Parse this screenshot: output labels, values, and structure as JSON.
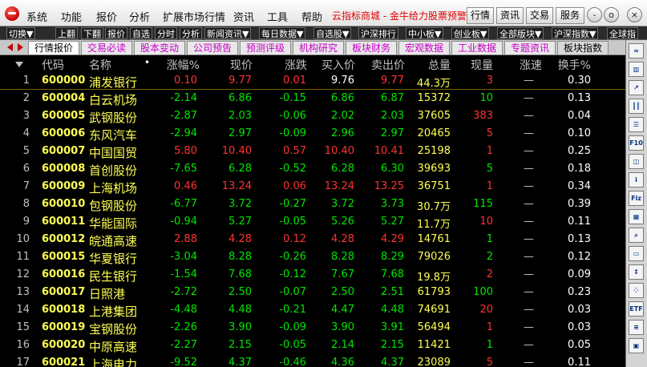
{
  "menu": {
    "items": [
      "系统",
      "功能",
      "报价",
      "分析",
      "扩展市场行情",
      "资讯",
      "工具",
      "帮助"
    ],
    "title": "云指标商城 - 金牛给力股票预警",
    "modes": [
      "行情",
      "资讯",
      "交易",
      "服务"
    ]
  },
  "window_controls": [
    "-",
    "o",
    "□",
    "×"
  ],
  "toolbar": [
    "切换▼",
    "上翻",
    "下翻",
    "报价",
    "自选",
    "分时",
    "分析",
    "新闻资讯▼",
    "每日数据▼",
    "自选股▼",
    "沪深排行",
    "中小板▼",
    "创业板▼",
    "全部版块▼",
    "沪深指数▼",
    "全球指"
  ],
  "tabs": [
    "行情报价",
    "交易必读",
    "股本变动",
    "公司预告",
    "预测评级",
    "机构研究",
    "板块财务",
    "宏观数据",
    "工业数据",
    "专题资讯",
    "板块指数"
  ],
  "table": {
    "sort_marker": "•",
    "columns": [
      "代码",
      "名称",
      "涨幅%",
      "现价",
      "涨跌",
      "买入价",
      "卖出价",
      "总量",
      "现量",
      "涨速",
      "换手%"
    ],
    "rows": [
      {
        "n": "1",
        "code": "600000",
        "name": "浦发银行",
        "pct": "0.10",
        "price": "9.77",
        "chg": "0.01",
        "bid": "9.76",
        "ask": "9.77",
        "vol": "44.3万",
        "cur": "3",
        "speed": "—",
        "turn": "0.30",
        "dir": "up",
        "bid_dir": "flat",
        "ask_dir": "up",
        "cur_dir": "up"
      },
      {
        "n": "2",
        "code": "600004",
        "name": "白云机场",
        "pct": "-2.14",
        "price": "6.86",
        "chg": "-0.15",
        "bid": "6.86",
        "ask": "6.87",
        "vol": "15372",
        "cur": "10",
        "speed": "—",
        "turn": "0.13",
        "dir": "dn",
        "bid_dir": "dn",
        "ask_dir": "dn",
        "cur_dir": "dn"
      },
      {
        "n": "3",
        "code": "600005",
        "name": "武钢股份",
        "pct": "-2.87",
        "price": "2.03",
        "chg": "-0.06",
        "bid": "2.02",
        "ask": "2.03",
        "vol": "37605",
        "cur": "383",
        "speed": "—",
        "turn": "0.04",
        "dir": "dn",
        "bid_dir": "dn",
        "ask_dir": "dn",
        "cur_dir": "up"
      },
      {
        "n": "4",
        "code": "600006",
        "name": "东风汽车",
        "pct": "-2.94",
        "price": "2.97",
        "chg": "-0.09",
        "bid": "2.96",
        "ask": "2.97",
        "vol": "20465",
        "cur": "5",
        "speed": "—",
        "turn": "0.10",
        "dir": "dn",
        "bid_dir": "dn",
        "ask_dir": "dn",
        "cur_dir": "up"
      },
      {
        "n": "5",
        "code": "600007",
        "name": "中国国贸",
        "pct": "5.80",
        "price": "10.40",
        "chg": "0.57",
        "bid": "10.40",
        "ask": "10.41",
        "vol": "25198",
        "cur": "1",
        "speed": "—",
        "turn": "0.25",
        "dir": "up",
        "bid_dir": "up",
        "ask_dir": "up",
        "cur_dir": "up"
      },
      {
        "n": "6",
        "code": "600008",
        "name": "首创股份",
        "pct": "-7.65",
        "price": "6.28",
        "chg": "-0.52",
        "bid": "6.28",
        "ask": "6.30",
        "vol": "39693",
        "cur": "5",
        "speed": "—",
        "turn": "0.18",
        "dir": "dn",
        "bid_dir": "dn",
        "ask_dir": "dn",
        "cur_dir": "dn"
      },
      {
        "n": "7",
        "code": "600009",
        "name": "上海机场",
        "pct": "0.46",
        "price": "13.24",
        "chg": "0.06",
        "bid": "13.24",
        "ask": "13.25",
        "vol": "36751",
        "cur": "1",
        "speed": "—",
        "turn": "0.34",
        "dir": "up",
        "bid_dir": "up",
        "ask_dir": "up",
        "cur_dir": "up"
      },
      {
        "n": "8",
        "code": "600010",
        "name": "包钢股份",
        "pct": "-6.77",
        "price": "3.72",
        "chg": "-0.27",
        "bid": "3.72",
        "ask": "3.73",
        "vol": "30.7万",
        "cur": "115",
        "speed": "—",
        "turn": "0.39",
        "dir": "dn",
        "bid_dir": "dn",
        "ask_dir": "dn",
        "cur_dir": "dn"
      },
      {
        "n": "9",
        "code": "600011",
        "name": "华能国际",
        "pct": "-0.94",
        "price": "5.27",
        "chg": "-0.05",
        "bid": "5.26",
        "ask": "5.27",
        "vol": "11.7万",
        "cur": "10",
        "speed": "—",
        "turn": "0.11",
        "dir": "dn",
        "bid_dir": "dn",
        "ask_dir": "dn",
        "cur_dir": "up"
      },
      {
        "n": "10",
        "code": "600012",
        "name": "皖通高速",
        "pct": "2.88",
        "price": "4.28",
        "chg": "0.12",
        "bid": "4.28",
        "ask": "4.29",
        "vol": "14761",
        "cur": "1",
        "speed": "—",
        "turn": "0.13",
        "dir": "up",
        "bid_dir": "up",
        "ask_dir": "up",
        "cur_dir": "dn"
      },
      {
        "n": "11",
        "code": "600015",
        "name": "华夏银行",
        "pct": "-3.04",
        "price": "8.28",
        "chg": "-0.26",
        "bid": "8.28",
        "ask": "8.29",
        "vol": "79026",
        "cur": "2",
        "speed": "—",
        "turn": "0.12",
        "dir": "dn",
        "bid_dir": "dn",
        "ask_dir": "dn",
        "cur_dir": "dn"
      },
      {
        "n": "12",
        "code": "600016",
        "name": "民生银行",
        "pct": "-1.54",
        "price": "7.68",
        "chg": "-0.12",
        "bid": "7.67",
        "ask": "7.68",
        "vol": "19.8万",
        "cur": "2",
        "speed": "—",
        "turn": "0.09",
        "dir": "dn",
        "bid_dir": "dn",
        "ask_dir": "dn",
        "cur_dir": "up"
      },
      {
        "n": "13",
        "code": "600017",
        "name": "日照港",
        "pct": "-2.72",
        "price": "2.50",
        "chg": "-0.07",
        "bid": "2.50",
        "ask": "2.51",
        "vol": "61793",
        "cur": "100",
        "speed": "—",
        "turn": "0.23",
        "dir": "dn",
        "bid_dir": "dn",
        "ask_dir": "dn",
        "cur_dir": "dn"
      },
      {
        "n": "14",
        "code": "600018",
        "name": "上港集团",
        "pct": "-4.48",
        "price": "4.48",
        "chg": "-0.21",
        "bid": "4.47",
        "ask": "4.48",
        "vol": "74691",
        "cur": "20",
        "speed": "—",
        "turn": "0.03",
        "dir": "dn",
        "bid_dir": "dn",
        "ask_dir": "dn",
        "cur_dir": "up"
      },
      {
        "n": "15",
        "code": "600019",
        "name": "宝钢股份",
        "pct": "-2.26",
        "price": "3.90",
        "chg": "-0.09",
        "bid": "3.90",
        "ask": "3.91",
        "vol": "56494",
        "cur": "1",
        "speed": "—",
        "turn": "0.03",
        "dir": "dn",
        "bid_dir": "dn",
        "ask_dir": "dn",
        "cur_dir": "up"
      },
      {
        "n": "16",
        "code": "600020",
        "name": "中原高速",
        "pct": "-2.27",
        "price": "2.15",
        "chg": "-0.05",
        "bid": "2.14",
        "ask": "2.15",
        "vol": "11421",
        "cur": "1",
        "speed": "—",
        "turn": "0.05",
        "dir": "dn",
        "bid_dir": "dn",
        "ask_dir": "dn",
        "cur_dir": "dn"
      },
      {
        "n": "17",
        "code": "600021",
        "name": "上海电力",
        "pct": "-9.52",
        "price": "4.37",
        "chg": "-0.46",
        "bid": "4.36",
        "ask": "4.37",
        "vol": "23089",
        "cur": "5",
        "speed": "—",
        "turn": "0.11",
        "dir": "dn",
        "bid_dir": "dn",
        "ask_dir": "dn",
        "cur_dir": "up"
      }
    ]
  },
  "sidebar_icons": [
    {
      "name": "minute-chart-icon",
      "label": "≈"
    },
    {
      "name": "kline-chart-icon",
      "label": "▥"
    },
    {
      "name": "trend-chart-icon",
      "label": "↗"
    },
    {
      "name": "candlestick-icon",
      "label": "┃┃"
    },
    {
      "name": "list-icon",
      "label": "☰"
    },
    {
      "name": "f10-icon",
      "label": "F10"
    },
    {
      "name": "indicator-icon",
      "label": "◫"
    },
    {
      "name": "info-icon",
      "label": "i"
    },
    {
      "name": "fiz-icon",
      "label": "Fiz"
    },
    {
      "name": "grid-icon",
      "label": "▦"
    },
    {
      "name": "search-icon",
      "label": "⌕"
    },
    {
      "name": "folder-icon",
      "label": "▭"
    },
    {
      "name": "sort-icon",
      "label": "↕"
    },
    {
      "name": "dot-grid-icon",
      "label": "⁘"
    },
    {
      "name": "etf-icon",
      "label": "ETF"
    },
    {
      "name": "bar-list-icon",
      "label": "≡"
    },
    {
      "name": "window-icon",
      "label": "▣"
    }
  ]
}
